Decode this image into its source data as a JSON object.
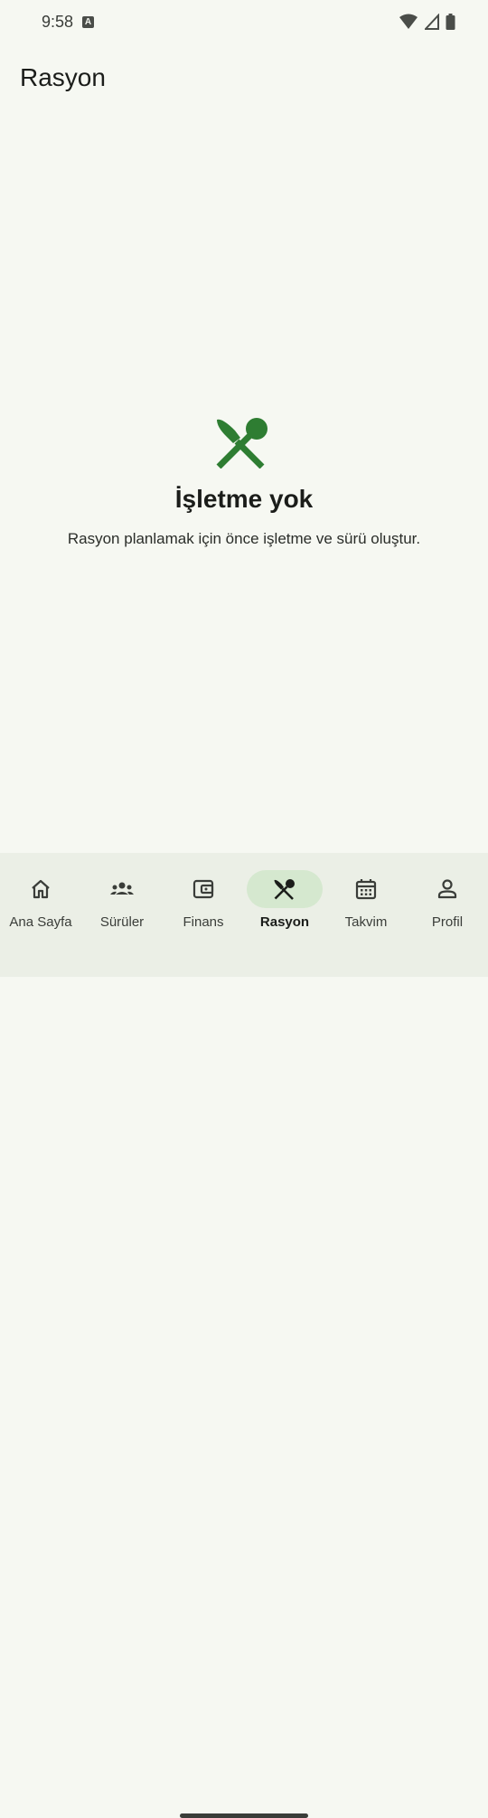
{
  "status_bar": {
    "time": "9:58",
    "notification_icon": "A"
  },
  "app_bar": {
    "title": "Rasyon"
  },
  "empty_state": {
    "icon": "restaurant-icon",
    "title": "İşletme yok",
    "description": "Rasyon planlamak için önce işletme ve sürü oluştur."
  },
  "colors": {
    "accent": "#2e7d32",
    "active_pill": "#d5e8cf",
    "background": "#f6f8f2",
    "nav_background": "#ebefe6"
  },
  "bottom_nav": {
    "items": [
      {
        "label": "Ana Sayfa",
        "icon": "home-icon",
        "active": false
      },
      {
        "label": "Sürüler",
        "icon": "groups-icon",
        "active": false
      },
      {
        "label": "Finans",
        "icon": "wallet-icon",
        "active": false
      },
      {
        "label": "Rasyon",
        "icon": "restaurant-icon",
        "active": true
      },
      {
        "label": "Takvim",
        "icon": "calendar-icon",
        "active": false
      },
      {
        "label": "Profil",
        "icon": "person-icon",
        "active": false
      }
    ]
  }
}
